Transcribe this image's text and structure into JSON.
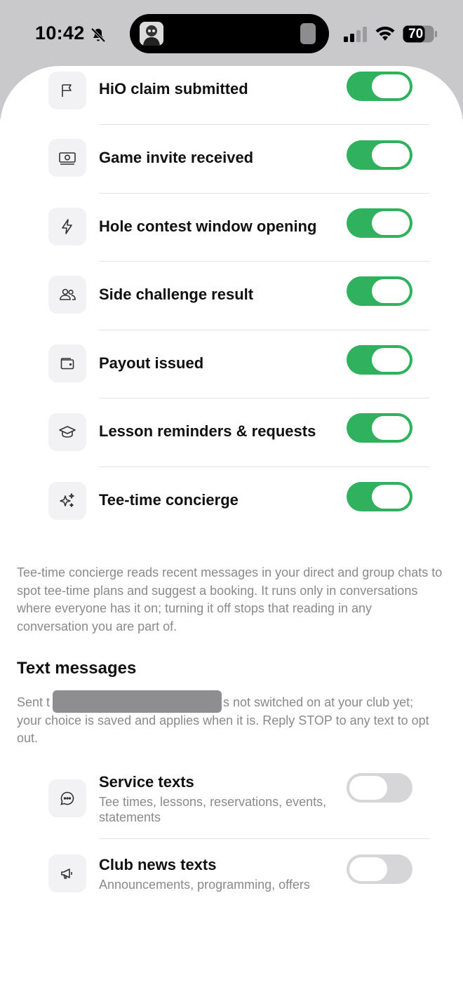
{
  "status_bar": {
    "time": "10:42",
    "battery_level": "70",
    "icons": [
      "bell-slash-icon",
      "signal-icon",
      "wifi-icon",
      "battery-icon"
    ]
  },
  "notifications": [
    {
      "label": "HiO claim submitted",
      "icon": "flag-icon",
      "enabled": true
    },
    {
      "label": "Game invite received",
      "icon": "cash-icon",
      "enabled": true
    },
    {
      "label": "Hole contest window opening",
      "icon": "bolt-icon",
      "enabled": true
    },
    {
      "label": "Side challenge result",
      "icon": "users-icon",
      "enabled": true
    },
    {
      "label": "Payout issued",
      "icon": "wallet-icon",
      "enabled": true
    },
    {
      "label": "Lesson reminders & requests",
      "icon": "graduation-cap-icon",
      "enabled": true
    },
    {
      "label": "Tee-time concierge",
      "icon": "sparkles-icon",
      "enabled": true
    }
  ],
  "concierge_note": "Tee-time concierge reads recent messages in your direct and group chats to spot tee-time plans and suggest a booking. It runs only in conversations where everyone has it on; turning it off stops that reading in any conversation you are part of.",
  "text_messages": {
    "title": "Text messages",
    "desc_line1_start": "Sent t",
    "desc_line1_end": "s not switched on at your club yet;",
    "desc_rest": "your choice is saved and applies when it is. Reply STOP to any text to opt out.",
    "items": [
      {
        "label": "Service texts",
        "sub": "Tee times, lessons, reservations, events, statements",
        "icon": "chat-bubble-icon",
        "enabled": false
      },
      {
        "label": "Club news texts",
        "sub": "Announcements, programming, offers",
        "icon": "megaphone-icon",
        "enabled": false
      }
    ]
  },
  "colors": {
    "toggle_on": "#2fb15d",
    "toggle_off": "#d6d6d8",
    "secondary_text": "#8a8a8e"
  }
}
